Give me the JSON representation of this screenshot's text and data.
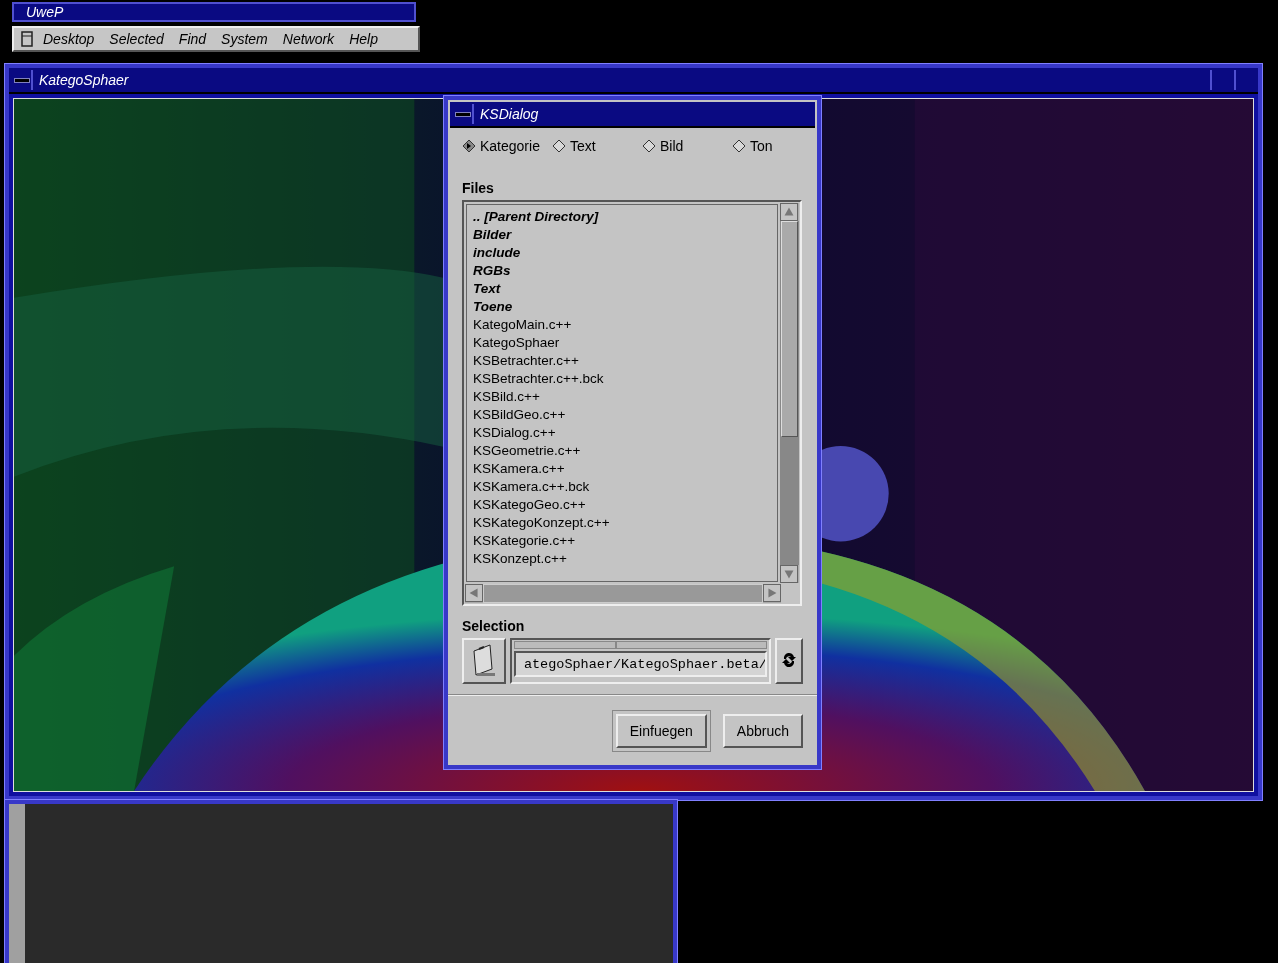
{
  "toolchest": {
    "title": "UweP",
    "menu": [
      "Desktop",
      "Selected",
      "Find",
      "System",
      "Network",
      "Help"
    ]
  },
  "main_window": {
    "title": "KategoSphaer"
  },
  "dialog": {
    "title": "KSDialog",
    "modes": [
      {
        "label": "Kategorie",
        "selected": true
      },
      {
        "label": "Text",
        "selected": false
      },
      {
        "label": "Bild",
        "selected": false
      },
      {
        "label": "Ton",
        "selected": false
      }
    ],
    "files_label": "Files",
    "files": [
      {
        "name": "..  [Parent Directory]",
        "kind": "dir"
      },
      {
        "name": "Bilder",
        "kind": "dir"
      },
      {
        "name": "include",
        "kind": "dir"
      },
      {
        "name": "RGBs",
        "kind": "dir"
      },
      {
        "name": "Text",
        "kind": "dir"
      },
      {
        "name": "Toene",
        "kind": "dir"
      },
      {
        "name": "KategoMain.c++",
        "kind": "file"
      },
      {
        "name": "KategoSphaer",
        "kind": "file"
      },
      {
        "name": "KSBetrachter.c++",
        "kind": "file"
      },
      {
        "name": "KSBetrachter.c++.bck",
        "kind": "file"
      },
      {
        "name": "KSBild.c++",
        "kind": "file"
      },
      {
        "name": "KSBildGeo.c++",
        "kind": "file"
      },
      {
        "name": "KSDialog.c++",
        "kind": "file"
      },
      {
        "name": "KSGeometrie.c++",
        "kind": "file"
      },
      {
        "name": "KSKamera.c++",
        "kind": "file"
      },
      {
        "name": "KSKamera.c++.bck",
        "kind": "file"
      },
      {
        "name": "KSKategoGeo.c++",
        "kind": "file"
      },
      {
        "name": "KSKategoKonzept.c++",
        "kind": "file"
      },
      {
        "name": "KSKategorie.c++",
        "kind": "file"
      },
      {
        "name": "KSKonzept.c++",
        "kind": "file"
      }
    ],
    "selection_label": "Selection",
    "selection_value": "ategoSphaer/KategoSphaer.beta/",
    "buttons": [
      {
        "label": "Einfuegen",
        "default": true
      },
      {
        "label": "Abbruch",
        "default": false
      }
    ]
  }
}
